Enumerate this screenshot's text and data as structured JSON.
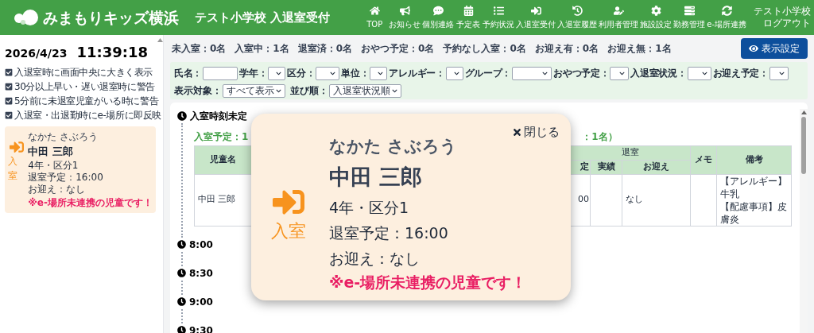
{
  "header": {
    "logo": "みまもりキッズ横浜",
    "title": "テスト小学校 入退室受付",
    "school": "テスト小学校",
    "logout": "ログアウト",
    "nav": [
      {
        "label": "TOP",
        "kind": "home"
      },
      {
        "label": "お知らせ",
        "kind": "bullhorn"
      },
      {
        "label": "個別連絡",
        "kind": "chat"
      },
      {
        "label": "予定表",
        "kind": "calendar"
      },
      {
        "label": "予約状況",
        "kind": "list"
      },
      {
        "label": "入退室受付",
        "kind": "signin"
      },
      {
        "label": "入退室履歴",
        "kind": "history"
      },
      {
        "label": "利用者管理",
        "kind": "useredit"
      },
      {
        "label": "施設設定",
        "kind": "gear"
      },
      {
        "label": "勤務管理",
        "kind": "server"
      },
      {
        "label": "e-場所連携",
        "kind": "sync"
      }
    ]
  },
  "sidebar": {
    "date": "2026/4/23",
    "time": "11:39:18",
    "settings": [
      {
        "label": "入退室時に画面中央に大きく表示",
        "checked": true
      },
      {
        "label": "30分以上早い・遅い退室時に警告",
        "checked": true
      },
      {
        "label": "5分前に未退室児童がいる時に警告",
        "checked": true
      },
      {
        "label": "入退室・出退勤時にe-場所に即反映",
        "checked": true
      }
    ],
    "card": {
      "badge": "入室",
      "kana": "なかた さぶろう",
      "name": "中田 三郎",
      "grade": "4年・区分1",
      "departure": "退室予定：16:00",
      "pickup": "お迎え：なし",
      "warning": "※e-場所未連携の児童です！"
    }
  },
  "summary": [
    "未入室：0名",
    "入室中：1名",
    "退室済：0名",
    "おやつ予定：0名",
    "予約なし入室：0名",
    "お迎え有：0名",
    "お迎え無：1名"
  ],
  "display_settings_button": "表示設定",
  "filters": [
    {
      "label": "氏名：",
      "kind": "text"
    },
    {
      "label": "学年：",
      "kind": "select"
    },
    {
      "label": "区分：",
      "kind": "select"
    },
    {
      "label": "単位：",
      "kind": "select"
    },
    {
      "label": "アレルギー：",
      "kind": "select"
    },
    {
      "label": "グループ：",
      "kind": "select"
    },
    {
      "label": "おやつ予定：",
      "kind": "select"
    },
    {
      "label": "入退室状況：",
      "kind": "select"
    },
    {
      "label": "お迎え予定：",
      "kind": "select"
    }
  ],
  "filters_row2": [
    {
      "label": "表示対象：",
      "value": "すべて表示"
    },
    {
      "label": "並び順：",
      "value": "入退室状況順"
    }
  ],
  "timeline": [
    {
      "time": "入室時刻未定",
      "group_heading_left": "入室予定：1",
      "group_heading_right": "：1名）",
      "table": {
        "columns": [
          "児童名",
          "定",
          "退室",
          "実績",
          "お迎え",
          "メモ",
          "備考"
        ],
        "rows": [
          {
            "name": "中田 三郎",
            "scheduled": "00",
            "actual": "",
            "pickup": "なし",
            "memo": "",
            "notes": [
              "【アレルギー】牛乳",
              "【配慮事項】皮膚炎"
            ]
          }
        ]
      }
    },
    {
      "time": "8:00"
    },
    {
      "time": "8:30"
    },
    {
      "time": "9:00"
    },
    {
      "time": "9:30"
    }
  ],
  "modal": {
    "close": "閉じる",
    "badge": "入室",
    "kana": "なかた さぶろう",
    "name": "中田 三郎",
    "grade": "4年・区分1",
    "departure": "退室予定：16:00",
    "pickup": "お迎え：なし",
    "warning": "※e-場所未連携の児童です！"
  }
}
